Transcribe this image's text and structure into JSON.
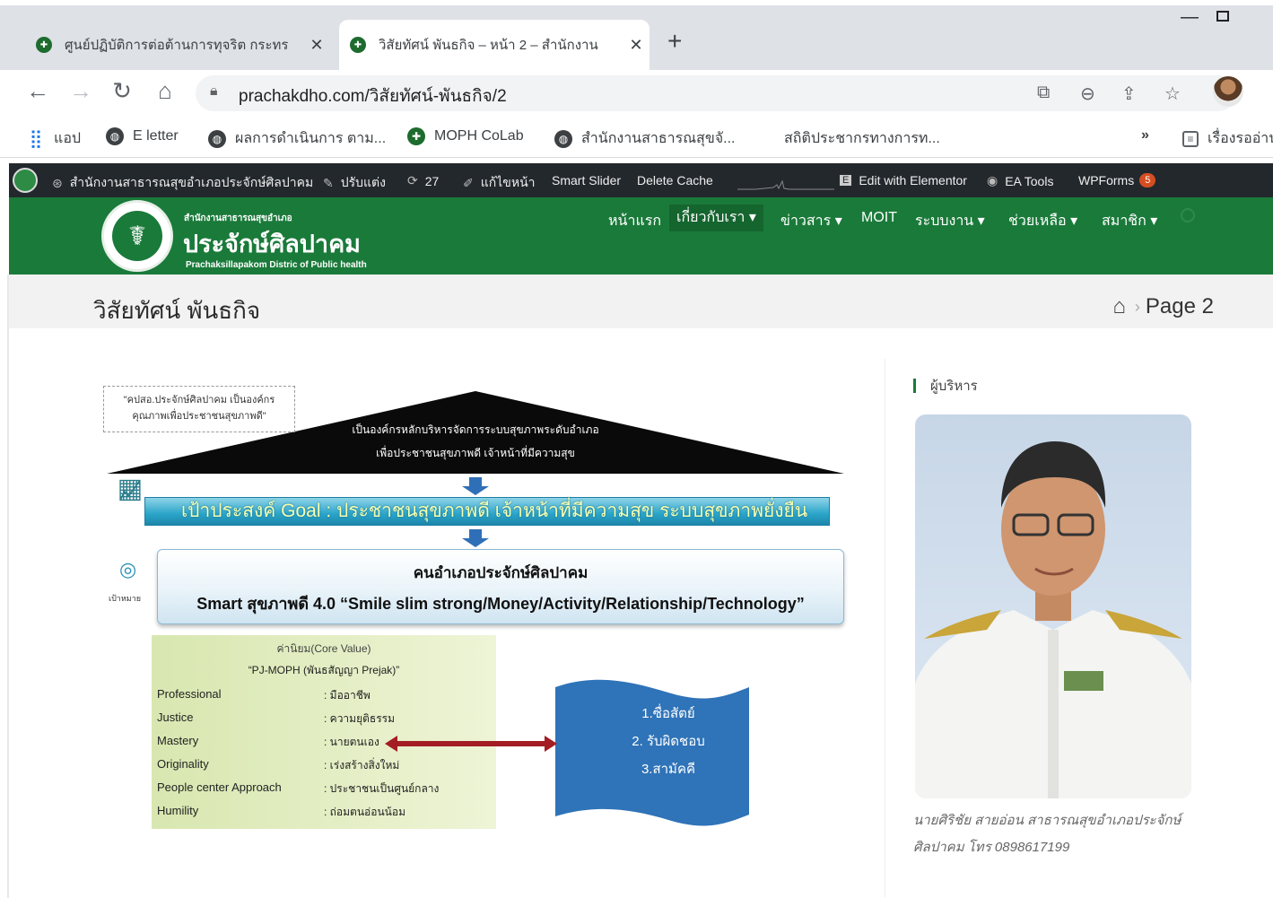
{
  "browser": {
    "tabs": [
      {
        "title": "ศูนย์ปฏิบัติการต่อต้านการทุจริต กระทร"
      },
      {
        "title": "วิสัยทัศน์ พันธกิจ – หน้า 2 – สำนักงาน"
      }
    ],
    "url": "prachakdho.com/วิสัยทัศน์-พันธกิจ/2",
    "bookmarks": [
      "แอป",
      "E letter",
      "ผลการดำเนินการ ตาม...",
      "MOPH CoLab",
      "สำนักงานสาธารณสุขจั...",
      "สถิติประชากรทางการท...",
      "»",
      "เรื่องรออ่าน"
    ]
  },
  "adminbar": {
    "site": "สำนักงานสาธารณสุขอำเภอประจักษ์ศิลปาคม",
    "customize": "ปรับแต่ง",
    "updates": "27",
    "edit_page": "แก้ไขหน้า",
    "smart_slider": "Smart Slider",
    "delete_cache": "Delete Cache",
    "elementor": "Edit with Elementor",
    "ea_tools": "EA Tools",
    "wpforms": "WPForms",
    "wpforms_count": "5"
  },
  "site": {
    "subtitle": "สำนักงานสาธารณสุขอำเภอ",
    "name": "ประจักษ์ศิลปาคม",
    "name_en": "Prachaksillapakom Distric of Public health",
    "nav": [
      "หน้าแรก",
      "เกี่ยวกับเรา ▾",
      "ข่าวสาร ▾",
      "MOIT",
      "ระบบงาน ▾",
      "ช่วยเหลือ ▾",
      "สมาชิก ▾"
    ]
  },
  "page": {
    "title": "วิสัยทัศน์ พันธกิจ",
    "breadcrumb_current": "Page 2"
  },
  "diagram": {
    "quote": [
      "\"คปสอ.ประจักษ์ศิลปาคม เป็นองค์กร",
      "คุณภาพเพื่อประชาชนสุขภาพดี\""
    ],
    "vision": [
      "เป็นองค์กรหลักบริหารจัดการระบบสุขภาพระดับอำเภอ",
      "เพื่อประชาชนสุขภาพดี เจ้าหน้าที่มีความสุข"
    ],
    "goal": "เป้าประสงค์  Goal : ประชาชนสุขภาพดี เจ้าหน้าที่มีความสุข ระบบสุขภาพยั่งยืน",
    "target_label": "เป้าหมาย",
    "target_title": "คนอำเภอประจักษ์ศิลปาคม",
    "target_text": "Smart สุขภาพดี 4.0  “Smile slim strong/Money/Activity/Relationship/Technology”",
    "core_title": "ค่านิยม(Core Value)",
    "core_subtitle": "“PJ-MOPH (พันธสัญญา Prejak)”",
    "core_values": [
      {
        "en": "Professional",
        "th": ": มืออาชีพ"
      },
      {
        "en": "Justice",
        "th": ": ความยุติธรรม"
      },
      {
        "en": "Mastery",
        "th": ": นายตนเอง"
      },
      {
        "en": "Originality",
        "th": ": เร่งสร้างสิ่งใหม่"
      },
      {
        "en": "People center Approach",
        "th": ": ประชาชนเป็นศูนย์กลาง"
      },
      {
        "en": "Humility",
        "th": ": ถ่อมตนอ่อนน้อม"
      }
    ],
    "values_flag": [
      "1.ซื่อสัตย์",
      "2. รับผิดชอบ",
      "3.สามัคคี"
    ]
  },
  "sidebar": {
    "title": "ผู้บริหาร",
    "caption": "นายศิริชัย สายอ่อน สาธารณสุขอำเภอประจักษ์ศิลปาคม โทร 0898617199"
  }
}
